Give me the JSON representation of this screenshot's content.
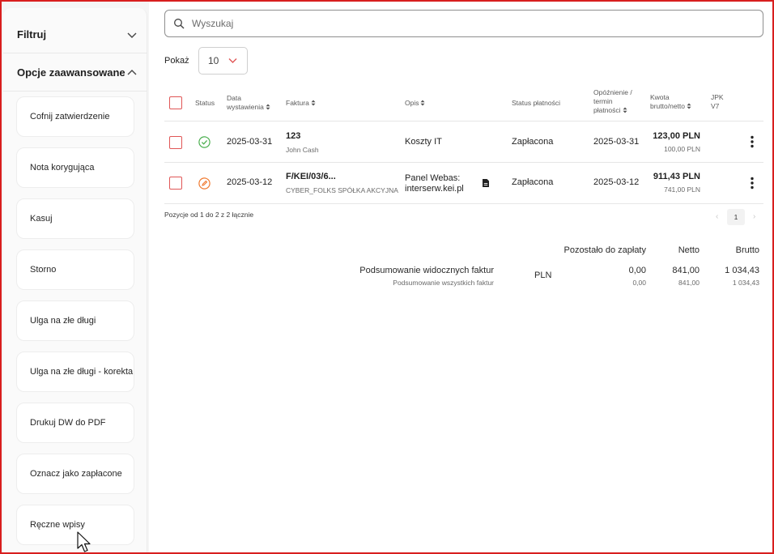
{
  "sidebar": {
    "filter_label": "Filtruj",
    "advanced_label": "Opcje zaawansowane",
    "buttons": [
      "Cofnij zatwierdzenie",
      "Nota korygująca",
      "Kasuj",
      "Storno",
      "Ulga na złe długi",
      "Ulga na złe długi - korekta",
      "Drukuj DW do PDF",
      "Oznacz jako zapłacone",
      "Ręczne wpisy"
    ]
  },
  "search": {
    "placeholder": "Wyszukaj",
    "icon": "search-icon"
  },
  "show": {
    "label": "Pokaż",
    "value": "10"
  },
  "table": {
    "headers": {
      "status": "Status",
      "date_l1": "Data",
      "date_l2": "wystawienia",
      "invoice": "Faktura",
      "description": "Opis",
      "payment_status": "Status płatności",
      "delay_l1": "Opóźnienie /",
      "delay_l2": "termin",
      "delay_l3": "płatności",
      "amount_l1": "Kwota",
      "amount_l2": "brutto/netto",
      "jpk_l1": "JPK",
      "jpk_l2": "V7"
    },
    "rows": [
      {
        "status_icon": "check-circle-icon",
        "date": "2025-03-31",
        "invoice_number": "123",
        "invoice_party": "John Cash",
        "description_l1": "Koszty IT",
        "description_l2": "",
        "payment_status": "Zapłacona",
        "due_date": "2025-03-31",
        "gross": "123,00 PLN",
        "net": "100,00 PLN"
      },
      {
        "status_icon": "pencil-circle-icon",
        "date": "2025-03-12",
        "invoice_number": "F/KEI/03/6...",
        "invoice_party": "CYBER_FOLKS SPÓŁKA AKCYJNA",
        "description_l1": "Panel Webas:",
        "description_l2": "interserw.kei.pl",
        "payment_status": "Zapłacona",
        "due_date": "2025-03-12",
        "gross": "911,43 PLN",
        "net": "741,00 PLN"
      }
    ],
    "colors": {
      "checkbox": "#e05656",
      "status_ok": "#4caf50",
      "status_edit": "#f07a30"
    }
  },
  "pagination": {
    "info": "Pozycje od 1 do 2 z 2 łącznie",
    "prev": "‹",
    "page": "1",
    "next": "›"
  },
  "summary": {
    "headers": {
      "remaining": "Pozostało do zapłaty",
      "net": "Netto",
      "gross": "Brutto"
    },
    "visible_label": "Podsumowanie widocznych faktur",
    "all_label": "Podsumowanie wszystkich faktur",
    "currency": "PLN",
    "visible": {
      "remaining": "0,00",
      "net": "841,00",
      "gross": "1 034,43"
    },
    "all": {
      "remaining": "0,00",
      "net": "841,00",
      "gross": "1 034,43"
    }
  }
}
